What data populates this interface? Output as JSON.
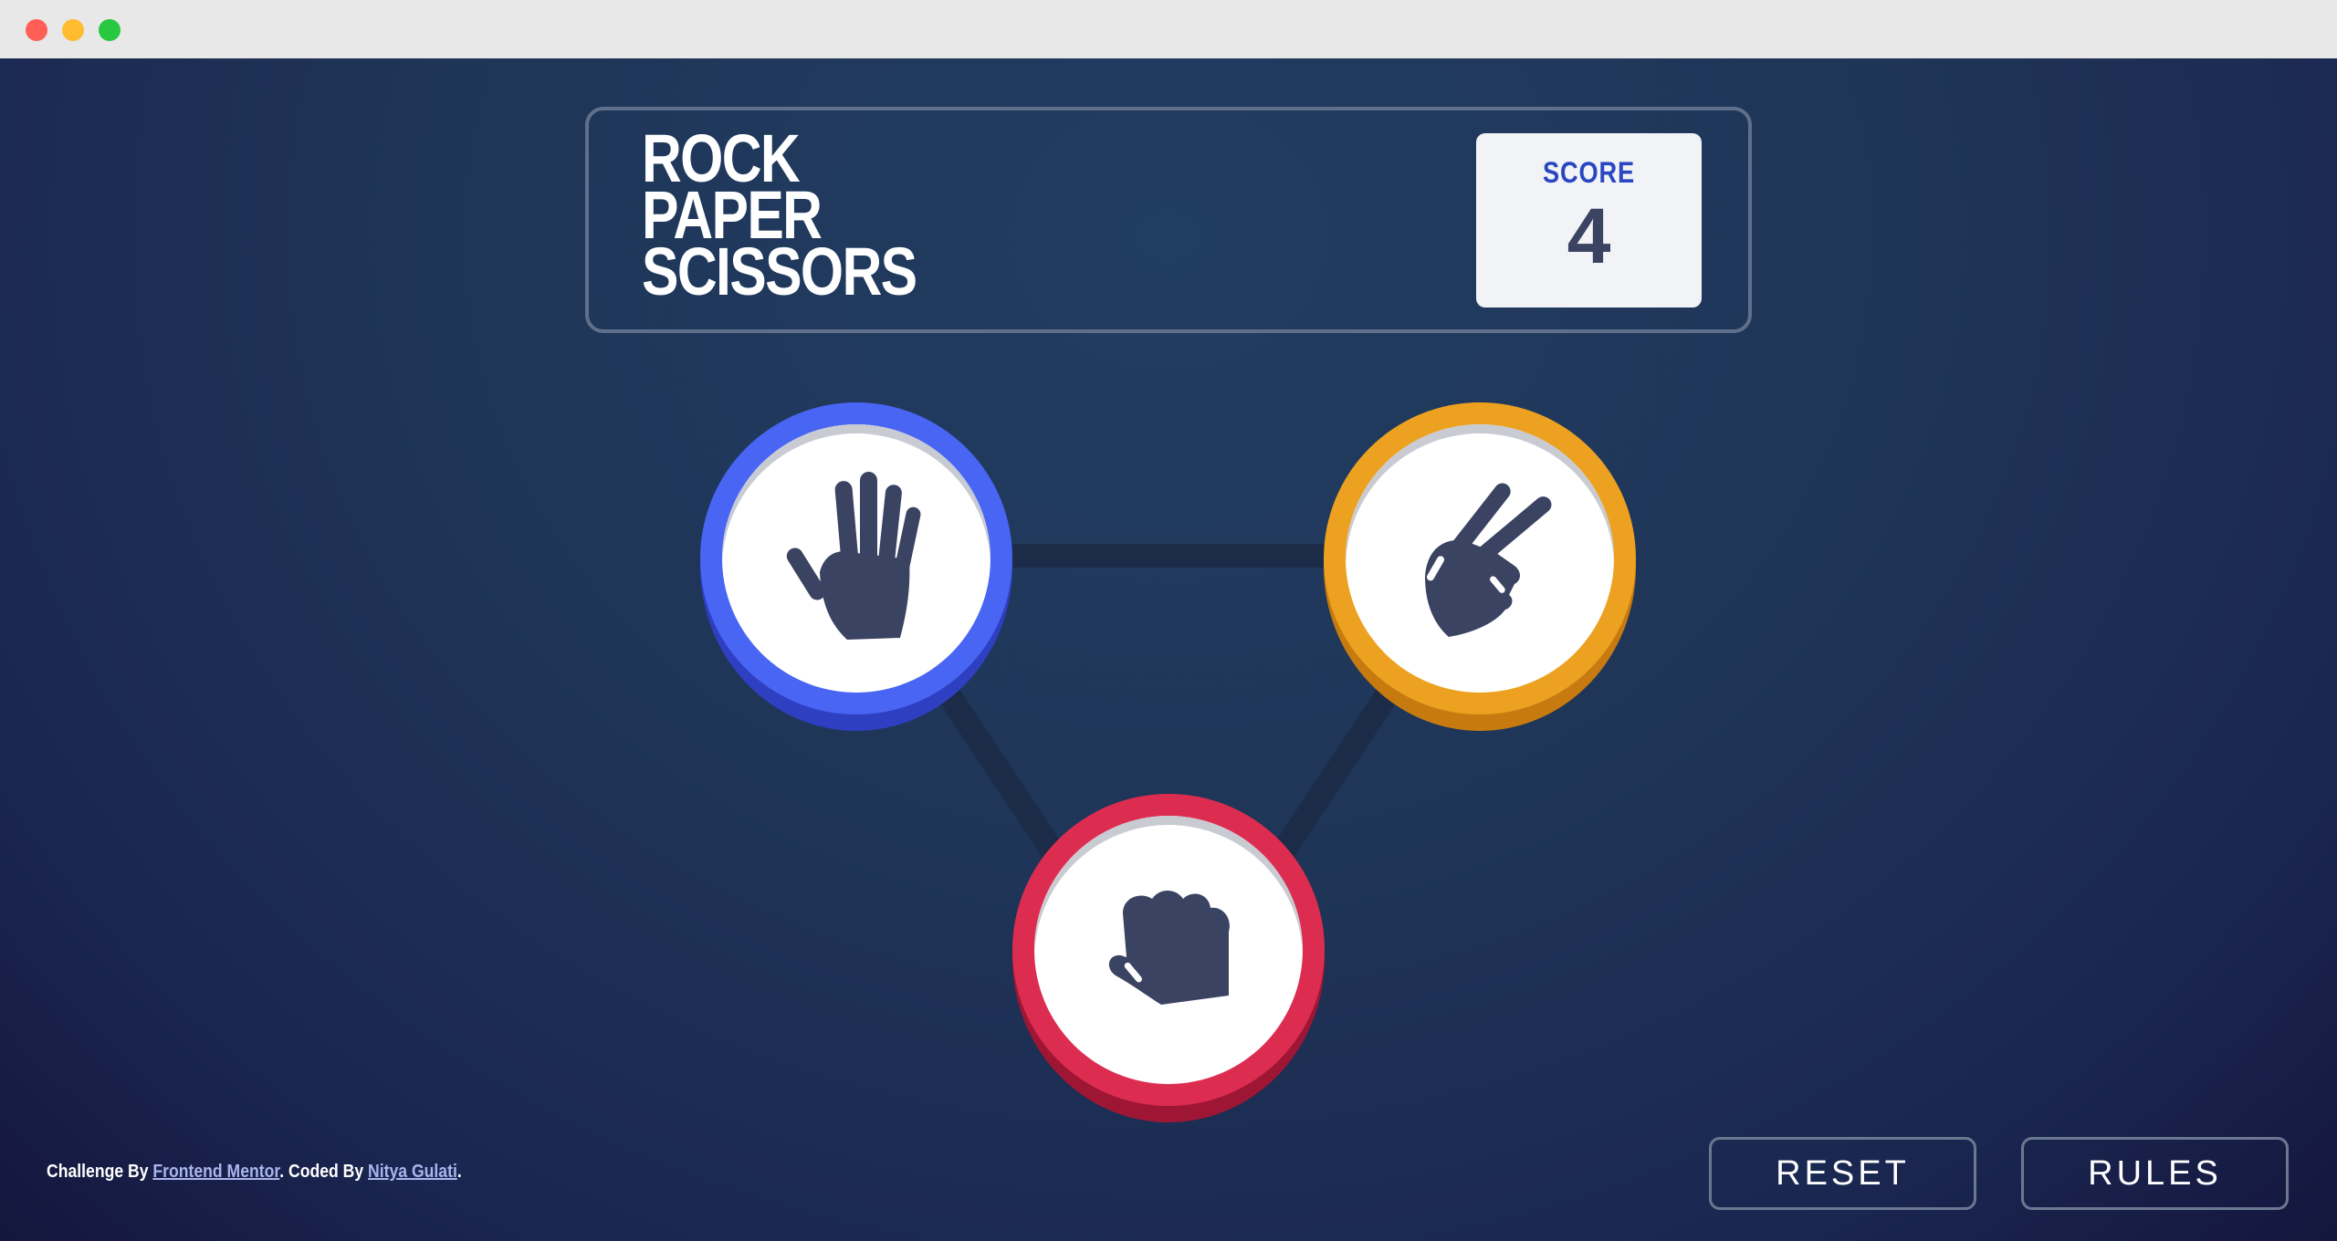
{
  "window": {
    "controls": [
      "close",
      "minimize",
      "maximize"
    ]
  },
  "header": {
    "title_lines": [
      "ROCK",
      "PAPER",
      "SCISSORS"
    ],
    "score_label": "SCORE",
    "score_value": "4"
  },
  "tokens": [
    {
      "id": "paper",
      "icon": "hand-paper-icon",
      "color": "#4865f4"
    },
    {
      "id": "scissors",
      "icon": "hand-scissors-icon",
      "color": "#eca121"
    },
    {
      "id": "rock",
      "icon": "hand-rock-icon",
      "color": "#dc2d51"
    }
  ],
  "footer": {
    "prefix": "Challenge By ",
    "link1": "Frontend Mentor",
    "middle": ". Coded By ",
    "link2": "Nitya Gulati",
    "suffix": "."
  },
  "buttons": {
    "reset": "RESET",
    "rules": "RULES"
  }
}
